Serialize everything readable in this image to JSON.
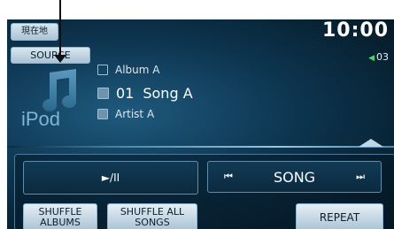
{
  "status": {
    "current_location_label": "現在地",
    "clock": "10:00",
    "volume": "03"
  },
  "source": {
    "label": "SOURCE"
  },
  "now_playing": {
    "album": "Album A",
    "track_number": "01",
    "song": "Song A",
    "artist": "Artist A",
    "art_text": "iPod"
  },
  "controls": {
    "play_pause": "►/II",
    "song_label": "SONG",
    "prev_icon": "⏮",
    "next_icon": "⏭",
    "shuffle_albums": "SHUFFLE\nALBUMS",
    "shuffle_all_songs": "SHUFFLE ALL\nSONGS",
    "repeat": "REPEAT"
  },
  "colors": {
    "accent": "#4fd36b",
    "background": "#0d3550"
  }
}
